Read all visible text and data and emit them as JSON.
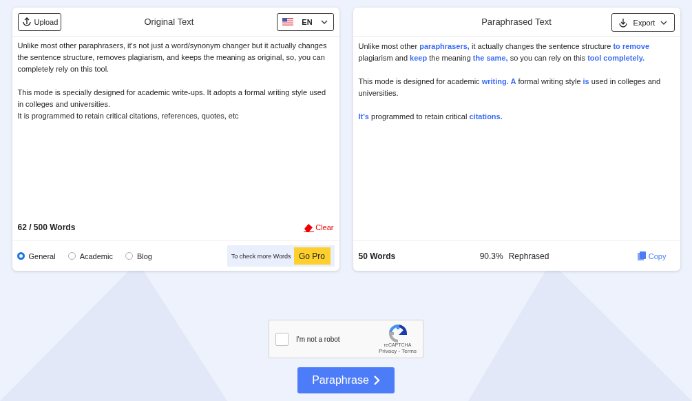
{
  "original": {
    "upload": "Upload",
    "title": "Original Text",
    "language": "EN",
    "paragraphs": [
      {
        "lines": [
          "Unlike most other paraphrasers, it's not just a word/synonym changer but it actually changes the sentence structure, removes plagiarism, and keeps the meaning as original, so, you can completely rely on this tool."
        ]
      },
      {
        "lines": [
          "This mode is specially designed for academic write-ups. It adopts a formal writing style used in colleges and universities.",
          "It is programmed to retain critical citations, references, quotes, etc"
        ]
      }
    ],
    "word_count": "62 / 500 Words",
    "clear": "Clear",
    "modes": [
      {
        "label": "General",
        "selected": true
      },
      {
        "label": "Academic",
        "selected": false
      },
      {
        "label": "Blog",
        "selected": false
      }
    ],
    "promo": "To check more Words",
    "go_pro": "Go Pro"
  },
  "paraphrased": {
    "title": "Paraphrased Text",
    "export": "Export",
    "paragraphs": [
      "Unlike most other **paraphrasers,** it actually changes the sentence structure **to remove** plagiarism and **keep** the meaning **the same,** so you can rely on this **tool completely.**",
      "This mode is designed for academic **writing. A** formal writing style **is** used in colleges and universities.",
      "**It's** programmed to retain critical **citations.**"
    ],
    "word_count": "50 Words",
    "percent": "90.3%",
    "rephrased": "Rephrased",
    "copy": "Copy"
  },
  "captcha": {
    "label": "I'm not a robot",
    "checked": false,
    "brand": "reCAPTCHA",
    "links": "Privacy - Terms"
  },
  "submit": "Paraphrase"
}
